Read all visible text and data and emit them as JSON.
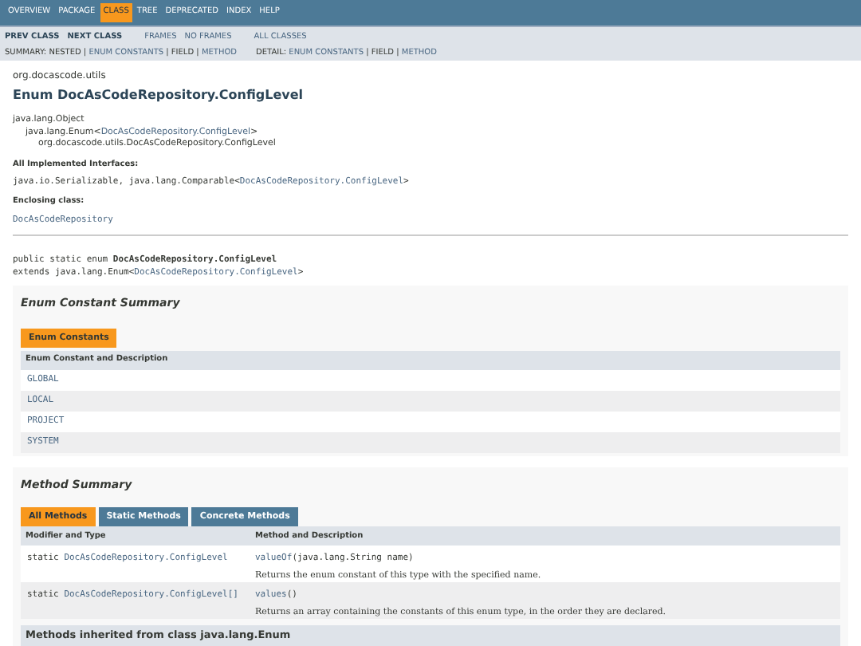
{
  "top_nav": [
    {
      "label": "OVERVIEW",
      "selected": false
    },
    {
      "label": "PACKAGE",
      "selected": false
    },
    {
      "label": "CLASS",
      "selected": true
    },
    {
      "label": "TREE",
      "selected": false
    },
    {
      "label": "DEPRECATED",
      "selected": false
    },
    {
      "label": "INDEX",
      "selected": false
    },
    {
      "label": "HELP",
      "selected": false
    }
  ],
  "sub_nav": {
    "groups": [
      [
        "PREV CLASS",
        "NEXT CLASS"
      ],
      [
        "FRAMES",
        "NO FRAMES"
      ],
      [
        "ALL CLASSES"
      ]
    ],
    "summary": [
      {
        "text": "SUMMARY: NESTED | ",
        "kind": "text"
      },
      {
        "text": "ENUM CONSTANTS",
        "kind": "link"
      },
      {
        "text": " | FIELD | ",
        "kind": "text"
      },
      {
        "text": "METHOD",
        "kind": "link"
      }
    ],
    "detail": [
      {
        "text": "DETAIL: ",
        "kind": "text"
      },
      {
        "text": "ENUM CONSTANTS",
        "kind": "link"
      },
      {
        "text": " | FIELD | ",
        "kind": "text"
      },
      {
        "text": "METHOD",
        "kind": "link"
      }
    ]
  },
  "package": "org.docascode.utils",
  "title": "Enum DocAsCodeRepository.ConfigLevel",
  "hierarchy": [
    {
      "text": "java.lang.Object",
      "children": [
        {
          "parts": [
            {
              "text": "java.lang.Enum<",
              "kind": "text"
            },
            {
              "text": "DocAsCodeRepository.ConfigLevel",
              "kind": "link"
            },
            {
              "text": ">",
              "kind": "text"
            }
          ],
          "children": [
            {
              "text": "org.docascode.utils.DocAsCodeRepository.ConfigLevel"
            }
          ]
        }
      ]
    }
  ],
  "interfaces": {
    "label": "All Implemented Interfaces:",
    "parts": [
      {
        "text": "java.io.Serializable, java.lang.Comparable<",
        "kind": "text"
      },
      {
        "text": "DocAsCodeRepository.ConfigLevel",
        "kind": "link"
      },
      {
        "text": ">",
        "kind": "text"
      }
    ]
  },
  "enclosing": {
    "label": "Enclosing class:",
    "link": "DocAsCodeRepository"
  },
  "declaration": {
    "line1": "public static enum **DocAsCodeRepository.ConfigLevel**",
    "line2": [
      {
        "text": "extends java.lang.Enum<",
        "kind": "text"
      },
      {
        "text": "DocAsCodeRepository.ConfigLevel",
        "kind": "link"
      },
      {
        "text": ">",
        "kind": "text"
      }
    ]
  },
  "enum_summary": {
    "title": "Enum Constant Summary",
    "tab": "Enum Constants",
    "header": "Enum Constant and Description",
    "rows": [
      "GLOBAL",
      "LOCAL",
      "PROJECT",
      "SYSTEM"
    ]
  },
  "method_summary": {
    "title": "Method Summary",
    "tabs": [
      {
        "label": "All Methods",
        "selected": true
      },
      {
        "label": "Static Methods",
        "selected": false
      },
      {
        "label": "Concrete Methods",
        "selected": false
      }
    ],
    "columns": [
      "Modifier and Type",
      "Method and Description"
    ],
    "rows": [
      {
        "modifier": "static ",
        "type": "DocAsCodeRepository.ConfigLevel",
        "method": "valueOf",
        "params": "(java.lang.String name)",
        "description": "Returns the enum constant of this type with the specified name."
      },
      {
        "modifier": "static ",
        "type": "DocAsCodeRepository.ConfigLevel[]",
        "method": "values",
        "params": "()",
        "description": "Returns an array containing the constants of this enum type, in the order they are declared."
      }
    ]
  },
  "inherited_heading": "Methods inherited from class java.lang.Enum"
}
